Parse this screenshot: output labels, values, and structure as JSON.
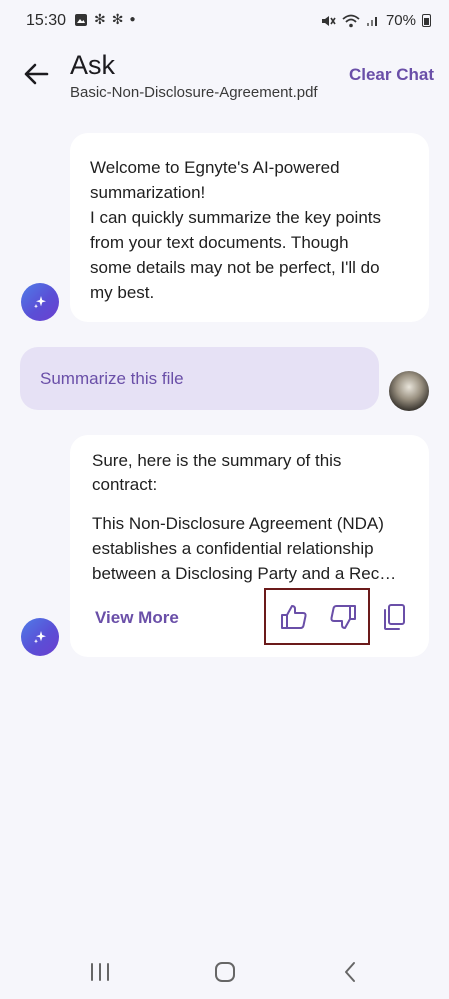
{
  "status_bar": {
    "time": "15:30",
    "battery": "70%",
    "left_icons": [
      "image-icon",
      "snowflake-icon",
      "snowflake-icon",
      "dot-icon"
    ],
    "right_icons": [
      "mute-icon",
      "wifi-icon",
      "signal-icon",
      "battery-icon"
    ]
  },
  "header": {
    "title": "Ask",
    "file_name": "Basic-Non-Disclosure-Agreement.pdf",
    "clear_chat_label": "Clear Chat",
    "back_icon": "arrow-left-icon"
  },
  "messages": [
    {
      "sender": "ai",
      "text": "Welcome to Egnyte's AI-powered\nsummarization!\nI can quickly summarize the key points\nfrom your text documents. Though\nsome details may not be perfect, I'll do\nmy best."
    },
    {
      "sender": "user",
      "text": "Summarize this file"
    },
    {
      "sender": "ai",
      "intro": "Sure, here is the summary of this contract:",
      "summary": "This Non-Disclosure Agreement (NDA) establishes a confidential relationship between a Disclosing Party and a Rec…",
      "view_more_label": "View More",
      "actions": [
        "thumbs-up-icon",
        "thumbs-down-icon",
        "copy-icon"
      ]
    }
  ],
  "colors": {
    "accent": "#6a4fa8",
    "background": "#f6f6fb",
    "user_bubble": "#e6e1f5",
    "highlight_border": "#6b1a1a"
  },
  "nav_bar": {
    "icons": [
      "recents-icon",
      "home-icon",
      "nav-back-icon"
    ]
  }
}
